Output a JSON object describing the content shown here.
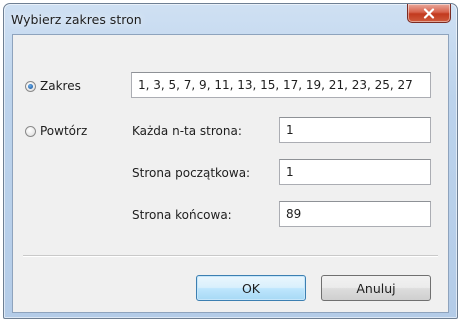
{
  "window": {
    "title": "Wybierz zakres stron",
    "close_symbol": "x"
  },
  "range_option": {
    "label": "Zakres",
    "selected": true,
    "value": "1, 3, 5, 7, 9, 11, 13, 15, 17, 19, 21, 23, 25, 27"
  },
  "repeat_option": {
    "label": "Powtórz",
    "selected": false,
    "fields": [
      {
        "label": "Każda n-ta strona:",
        "value": "1"
      },
      {
        "label": "Strona początkowa:",
        "value": "1"
      },
      {
        "label": "Strona końcowa:",
        "value": "89"
      }
    ]
  },
  "buttons": {
    "ok": "OK",
    "cancel": "Anuluj"
  },
  "colors": {
    "title_bar": "#bcd3ec",
    "close_button": "#c9452b",
    "dialog_body": "#f0f0f0",
    "default_button": "#bee6fd"
  },
  "icons": {
    "close": "close-icon"
  }
}
